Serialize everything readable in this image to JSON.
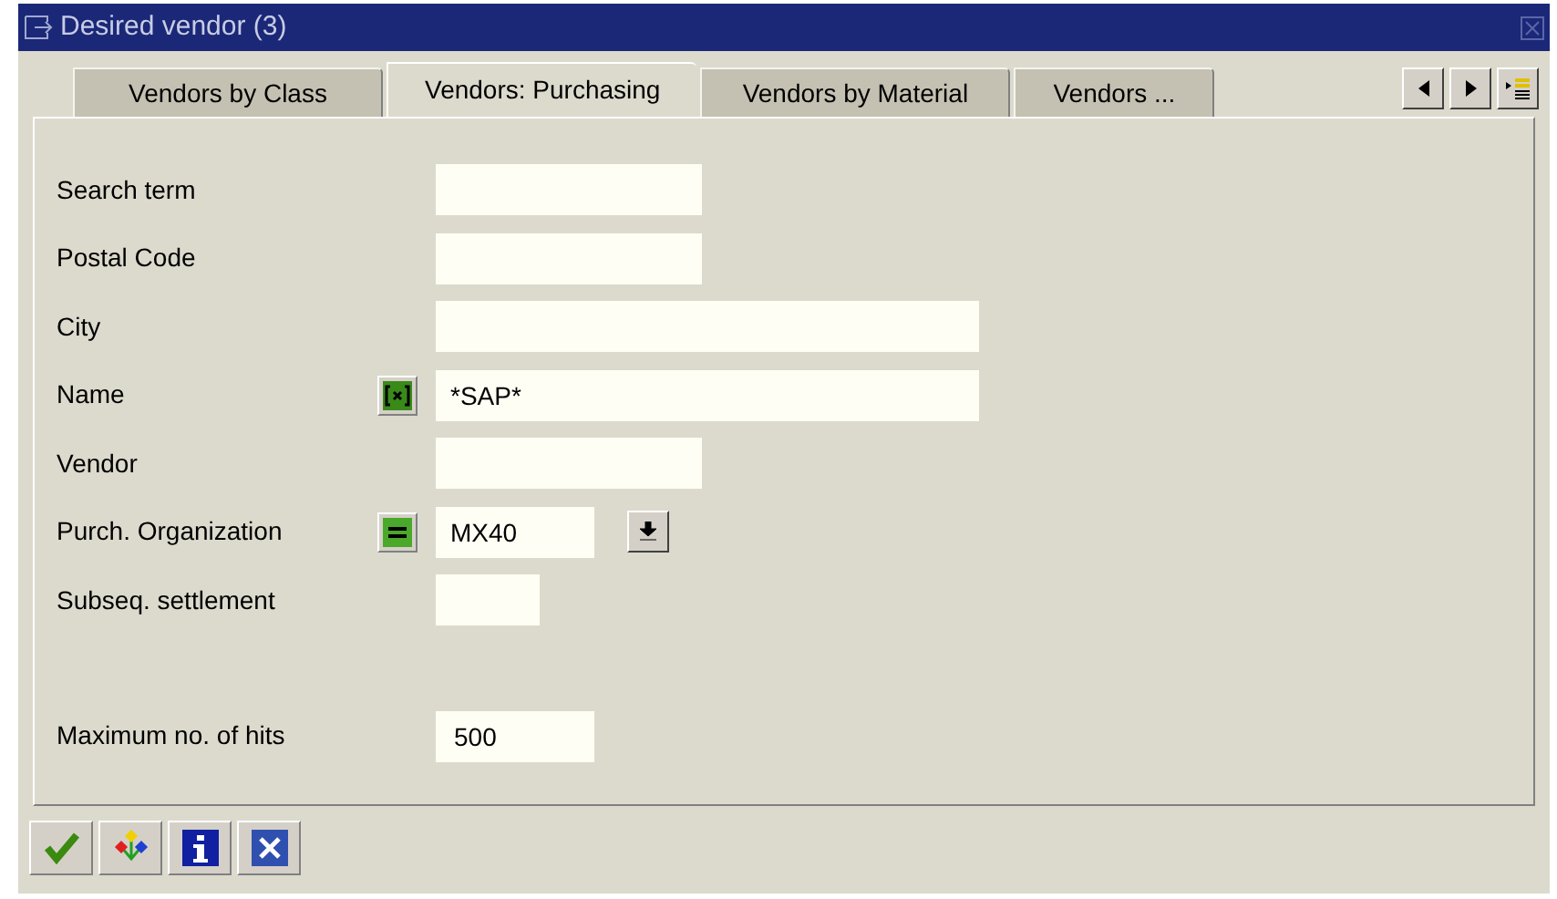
{
  "window": {
    "title": "Desired vendor (3)"
  },
  "tabs": [
    {
      "label": "Vendors by Class",
      "selected": false
    },
    {
      "label": "Vendors: Purchasing",
      "selected": true
    },
    {
      "label": "Vendors by Material",
      "selected": false
    },
    {
      "label": "Vendors ...",
      "selected": false
    }
  ],
  "fields": [
    {
      "label": "Search term"
    },
    {
      "label": "Postal Code"
    },
    {
      "label": "City"
    },
    {
      "label": "Name",
      "value": "*SAP*",
      "kind": "pattern"
    },
    {
      "label": "Vendor"
    },
    {
      "label": "Purch. Organization",
      "value": "MX40",
      "kind": "equals",
      "dropdown": true
    },
    {
      "label": "Subseq. settlement"
    }
  ],
  "max_hits": {
    "label": "Maximum no. of hits",
    "value": "500"
  }
}
